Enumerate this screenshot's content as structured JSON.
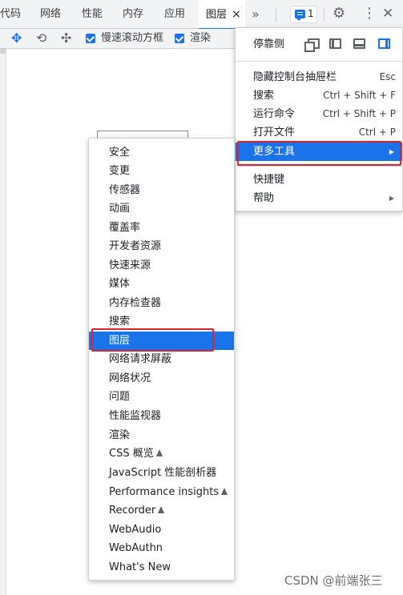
{
  "tabs": [
    {
      "label": "代码"
    },
    {
      "label": "网络"
    },
    {
      "label": "性能"
    },
    {
      "label": "内存"
    },
    {
      "label": "应用"
    },
    {
      "label": "图层",
      "close": "×"
    }
  ],
  "tabbar": {
    "overflow": "»",
    "issues_count": "1",
    "settings_icon": "gear-icon",
    "more_icon": "kebab-icon",
    "close": "✕"
  },
  "toolbar": {
    "pan_icon": "move-icon",
    "rotate_icon": "rotate-icon",
    "reset_icon": "reset-transform-icon",
    "slow_scroll_label": "慢速滚动方框",
    "slow_scroll_checked": true,
    "paint_label": "渲染",
    "paint_checked": true
  },
  "main_menu": {
    "dock_label": "停靠侧",
    "items": [
      {
        "label": "隐藏控制台抽屉栏",
        "shortcut": "Esc"
      },
      {
        "label": "搜索",
        "shortcut": "Ctrl + Shift + F"
      },
      {
        "label": "运行命令",
        "shortcut": "Ctrl + Shift + P"
      },
      {
        "label": "打开文件",
        "shortcut": "Ctrl + P"
      },
      {
        "label": "更多工具",
        "submenu": true,
        "highlighted": true
      }
    ],
    "items2": [
      {
        "label": "快捷键"
      },
      {
        "label": "帮助",
        "submenu": true
      }
    ]
  },
  "sub_menu": {
    "items": [
      {
        "label": "安全"
      },
      {
        "label": "变更"
      },
      {
        "label": "传感器"
      },
      {
        "label": "动画"
      },
      {
        "label": "覆盖率"
      },
      {
        "label": "开发者资源"
      },
      {
        "label": "快速来源"
      },
      {
        "label": "媒体"
      },
      {
        "label": "内存检查器"
      },
      {
        "label": "搜索"
      },
      {
        "label": "图层",
        "highlighted": true
      },
      {
        "label": "网络请求屏蔽"
      },
      {
        "label": "网络状况"
      },
      {
        "label": "问题"
      },
      {
        "label": "性能监视器"
      },
      {
        "label": "渲染"
      },
      {
        "label": "CSS 概览",
        "experimental": true
      },
      {
        "label": "JavaScript 性能剖析器"
      },
      {
        "label": "Performance insights",
        "experimental": true
      },
      {
        "label": "Recorder",
        "experimental": true
      },
      {
        "label": "WebAudio"
      },
      {
        "label": "WebAuthn"
      },
      {
        "label": "What's New"
      }
    ]
  },
  "watermark": "CSDN @前端张三",
  "colors": {
    "accent": "#1a73e8",
    "highlight_box": "#d9232e"
  }
}
